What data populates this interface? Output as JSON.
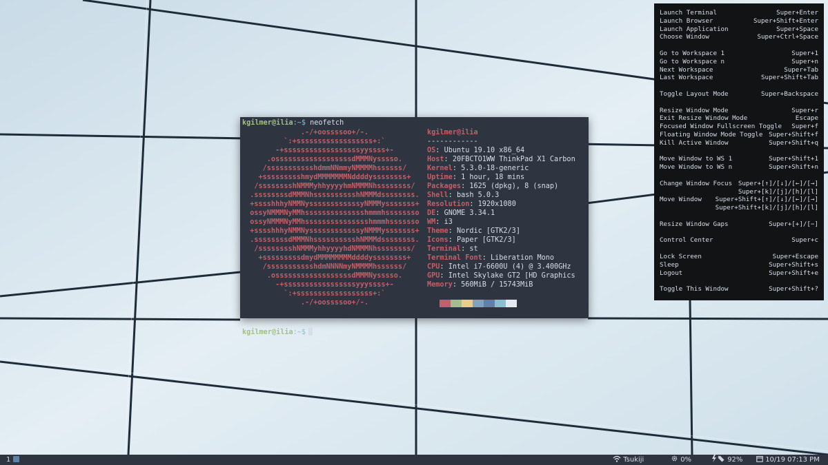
{
  "terminal": {
    "prompt_user": "kgilmer@ilia",
    "prompt_path": ":~$",
    "command": "neofetch",
    "logo_lines": [
      "              .-/+oossssoo+/-.",
      "          `:+ssssssssssssssssss+:`",
      "        -+ssssssssssssssssssyyssss+-",
      "      .ossssssssssssssssssdMMMNysssso.",
      "     /ssssssssssshdmmNNmmyNMMMMhssssss/",
      "    +ssssssssshmydMMMMMMMNddddyssssssss+",
      "   /sssssssshNMMMyhhyyyyhmNMMMNhssssssss/",
      "  .ssssssssdMMMNhsssssssssshNMMMdssssssss.",
      "  +sssshhhyNMMNyssssssssssssyNMMMysssssss+",
      "  ossyNMMMNyMMhsssssssssssssshmmmhssssssso",
      "  ossyNMMMNyMMhssssssssssssssshmmmhsssssso",
      "  +sssshhhyNMMNyssssssssssssyNMMMysssssss+",
      "  .ssssssssdMMMNhsssssssssshNMMMdssssssss.",
      "   /sssssssshNMMMyhhyyyyhdNMMMNhssssssss/",
      "    +sssssssssdmydMMMMMMMMddddyssssssss+",
      "     /ssssssssssshdmNNNNmyNMMMMhssssss/",
      "      .ossssssssssssssssssdMMMNysssso.",
      "        -+sssssssssssssssssyyyssss+-",
      "          `:+ssssssssssssssssss+:`",
      "              .-/+oossssoo+/-."
    ],
    "info_title": "kgilmer@ilia",
    "info_separator": "------------",
    "info": [
      {
        "key": "OS",
        "value": "Ubuntu 19.10 x86_64"
      },
      {
        "key": "Host",
        "value": "20FBCTO1WW ThinkPad X1 Carbon"
      },
      {
        "key": "Kernel",
        "value": "5.3.0-18-generic"
      },
      {
        "key": "Uptime",
        "value": "1 hour, 18 mins"
      },
      {
        "key": "Packages",
        "value": "1625 (dpkg), 8 (snap)"
      },
      {
        "key": "Shell",
        "value": "bash 5.0.3"
      },
      {
        "key": "Resolution",
        "value": "1920x1080"
      },
      {
        "key": "DE",
        "value": "GNOME 3.34.1"
      },
      {
        "key": "WM",
        "value": "i3"
      },
      {
        "key": "Theme",
        "value": "Nordic [GTK2/3]"
      },
      {
        "key": "Icons",
        "value": "Paper [GTK2/3]"
      },
      {
        "key": "Terminal",
        "value": "st"
      },
      {
        "key": "Terminal Font",
        "value": "Liberation Mono"
      },
      {
        "key": "CPU",
        "value": "Intel i7-6600U (4) @ 3.400GHz"
      },
      {
        "key": "GPU",
        "value": "Intel Skylake GT2 [HD Graphics"
      },
      {
        "key": "Memory",
        "value": "560MiB / 15743MiB"
      }
    ],
    "swatch_colors": [
      "#bf616a",
      "#a3be8c",
      "#ebcb8b",
      "#81a1c1",
      "#5e81ac",
      "#88c0d0",
      "#e5e9f0"
    ]
  },
  "keybindings": [
    {
      "action": "Launch Terminal",
      "keys": "Super+Enter"
    },
    {
      "action": "Launch Browser",
      "keys": "Super+Shift+Enter"
    },
    {
      "action": "Launch Application",
      "keys": "Super+Space"
    },
    {
      "action": "Choose Window",
      "keys": "Super+Ctrl+Space"
    },
    {
      "action": "Go to Workspace 1",
      "keys": "Super+1"
    },
    {
      "action": "Go to Workspace n",
      "keys": "Super+n"
    },
    {
      "action": "Next Workspace",
      "keys": "Super+Tab"
    },
    {
      "action": "Last Workspace",
      "keys": "Super+Shift+Tab"
    },
    {
      "action": "Toggle Layout Mode",
      "keys": "Super+Backspace"
    },
    {
      "action": "Resize Window Mode",
      "keys": "Super+r"
    },
    {
      "action": "Exit Resize Window Mode",
      "keys": "Escape"
    },
    {
      "action": "Focused Window Fullscreen Toggle",
      "keys": "Super+f"
    },
    {
      "action": "Floating Window Mode Toggle",
      "keys": "Super+Shift+f"
    },
    {
      "action": "Kill Active Window",
      "keys": "Super+Shift+q"
    },
    {
      "action": "Move Window to WS 1",
      "keys": "Super+Shift+1"
    },
    {
      "action": "Move Window to WS n",
      "keys": "Super+Shift+n"
    },
    {
      "action": "Change Window Focus",
      "keys": "Super+[↑]/[↓]/[←]/[→]"
    },
    {
      "action": "",
      "keys": "Super+[k]/[j]/[h]/[l]"
    },
    {
      "action": "Move Window",
      "keys": "Super+Shift+[↑]/[↓]/[←]/[→]"
    },
    {
      "action": "",
      "keys": "Super+Shift+[k]/[j]/[h]/[l]"
    },
    {
      "action": "Resize Window Gaps",
      "keys": "Super+[+]/[−]"
    },
    {
      "action": "Control Center",
      "keys": "Super+c"
    },
    {
      "action": "Lock Screen",
      "keys": "Super+Escape"
    },
    {
      "action": "Sleep",
      "keys": "Super+Shift+s"
    },
    {
      "action": "Logout",
      "keys": "Super+Shift+e"
    },
    {
      "action": "Toggle This Window",
      "keys": "Super+Shift+?"
    }
  ],
  "statusbar": {
    "workspace": "1",
    "wifi_icon": "wifi-icon",
    "network": "Tsukiji",
    "cpu_icon": "gear-icon",
    "cpu": "0%",
    "battery_icon": "battery-charging-icon",
    "battery": "92%",
    "calendar_icon": "calendar-icon",
    "datetime": "10/19 07:13 PM"
  }
}
